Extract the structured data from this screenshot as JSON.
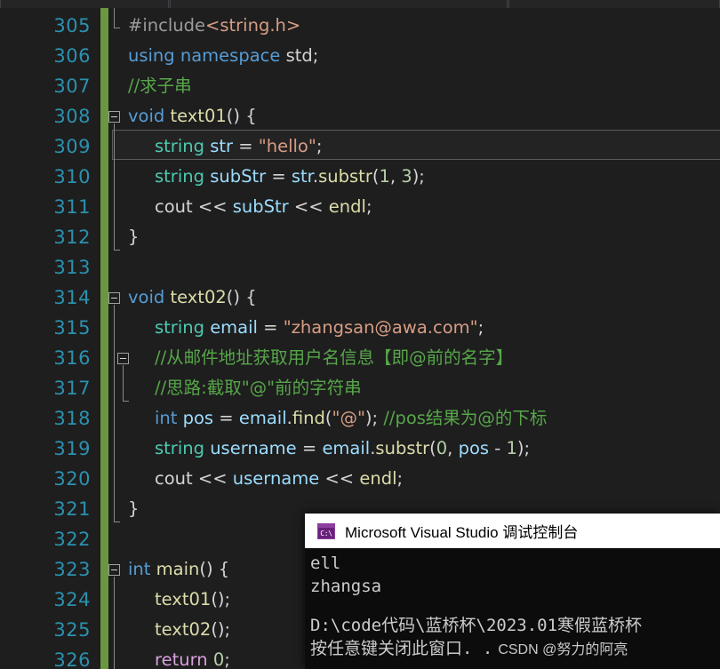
{
  "window": {
    "app": "Microsoft Visual Studio",
    "theme_name": "dark"
  },
  "editor": {
    "first_visible_line": 305,
    "last_visible_line": 326,
    "current_line": 309,
    "line_numbers": [
      "305",
      "306",
      "307",
      "308",
      "309",
      "310",
      "311",
      "312",
      "313",
      "314",
      "315",
      "316",
      "317",
      "318",
      "319",
      "320",
      "321",
      "322",
      "323",
      "324",
      "325",
      "326"
    ],
    "lines": [
      {
        "n": "305",
        "indent": 0,
        "tokens": [
          {
            "t": "#include",
            "c": "t-pre"
          },
          {
            "t": "<string.h>",
            "c": "t-prename"
          }
        ]
      },
      {
        "n": "306",
        "indent": 0,
        "tokens": [
          {
            "t": "using namespace ",
            "c": "t-kw"
          },
          {
            "t": "std",
            "c": "t-ns"
          },
          {
            "t": ";",
            "c": "t-punct"
          }
        ]
      },
      {
        "n": "307",
        "indent": 0,
        "tokens": [
          {
            "t": "//求子串",
            "c": "t-cmt"
          }
        ]
      },
      {
        "n": "308",
        "indent": 0,
        "tokens": [
          {
            "t": "void ",
            "c": "t-kw"
          },
          {
            "t": "text01",
            "c": "t-fn"
          },
          {
            "t": "() {",
            "c": "t-punct"
          }
        ]
      },
      {
        "n": "309",
        "indent": 1,
        "tokens": [
          {
            "t": "string ",
            "c": "t-type"
          },
          {
            "t": "str ",
            "c": "t-var"
          },
          {
            "t": "= ",
            "c": "t-op"
          },
          {
            "t": "\"hello\"",
            "c": "t-str"
          },
          {
            "t": ";",
            "c": "t-punct"
          }
        ]
      },
      {
        "n": "310",
        "indent": 1,
        "tokens": [
          {
            "t": "string ",
            "c": "t-type"
          },
          {
            "t": "subStr ",
            "c": "t-var"
          },
          {
            "t": "= ",
            "c": "t-op"
          },
          {
            "t": "str",
            "c": "t-var"
          },
          {
            "t": ".",
            "c": "t-punct"
          },
          {
            "t": "substr",
            "c": "t-fn"
          },
          {
            "t": "(",
            "c": "t-punct"
          },
          {
            "t": "1",
            "c": "t-num"
          },
          {
            "t": ", ",
            "c": "t-punct"
          },
          {
            "t": "3",
            "c": "t-num"
          },
          {
            "t": ");",
            "c": "t-punct"
          }
        ]
      },
      {
        "n": "311",
        "indent": 1,
        "tokens": [
          {
            "t": "cout ",
            "c": "t-punct"
          },
          {
            "t": "<< ",
            "c": "t-op"
          },
          {
            "t": "subStr ",
            "c": "t-var"
          },
          {
            "t": "<< ",
            "c": "t-op"
          },
          {
            "t": "endl",
            "c": "t-fn"
          },
          {
            "t": ";",
            "c": "t-punct"
          }
        ]
      },
      {
        "n": "312",
        "indent": 0,
        "tokens": [
          {
            "t": "}",
            "c": "t-punct"
          }
        ]
      },
      {
        "n": "313",
        "indent": 0,
        "tokens": []
      },
      {
        "n": "314",
        "indent": 0,
        "tokens": [
          {
            "t": "void ",
            "c": "t-kw"
          },
          {
            "t": "text02",
            "c": "t-fn"
          },
          {
            "t": "() {",
            "c": "t-punct"
          }
        ]
      },
      {
        "n": "315",
        "indent": 1,
        "tokens": [
          {
            "t": "string ",
            "c": "t-type"
          },
          {
            "t": "email ",
            "c": "t-var"
          },
          {
            "t": "= ",
            "c": "t-op"
          },
          {
            "t": "\"zhangsan@awa.com\"",
            "c": "t-str"
          },
          {
            "t": ";",
            "c": "t-punct"
          }
        ]
      },
      {
        "n": "316",
        "indent": 1,
        "tokens": [
          {
            "t": "//从邮件地址获取用户名信息【即@前的名字】",
            "c": "t-cmt"
          }
        ]
      },
      {
        "n": "317",
        "indent": 1,
        "tokens": [
          {
            "t": "//思路:截取\"@\"前的字符串",
            "c": "t-cmt"
          }
        ]
      },
      {
        "n": "318",
        "indent": 1,
        "tokens": [
          {
            "t": "int ",
            "c": "t-kw"
          },
          {
            "t": "pos ",
            "c": "t-var"
          },
          {
            "t": "= ",
            "c": "t-op"
          },
          {
            "t": "email",
            "c": "t-var"
          },
          {
            "t": ".",
            "c": "t-punct"
          },
          {
            "t": "find",
            "c": "t-fn"
          },
          {
            "t": "(",
            "c": "t-punct"
          },
          {
            "t": "\"@\"",
            "c": "t-str"
          },
          {
            "t": "); ",
            "c": "t-punct"
          },
          {
            "t": "//pos结果为@的下标",
            "c": "t-cmt"
          }
        ]
      },
      {
        "n": "319",
        "indent": 1,
        "tokens": [
          {
            "t": "string ",
            "c": "t-type"
          },
          {
            "t": "username ",
            "c": "t-var"
          },
          {
            "t": "= ",
            "c": "t-op"
          },
          {
            "t": "email",
            "c": "t-var"
          },
          {
            "t": ".",
            "c": "t-punct"
          },
          {
            "t": "substr",
            "c": "t-fn"
          },
          {
            "t": "(",
            "c": "t-punct"
          },
          {
            "t": "0",
            "c": "t-num"
          },
          {
            "t": ", ",
            "c": "t-punct"
          },
          {
            "t": "pos ",
            "c": "t-var"
          },
          {
            "t": "- ",
            "c": "t-op"
          },
          {
            "t": "1",
            "c": "t-num"
          },
          {
            "t": ");",
            "c": "t-punct"
          }
        ]
      },
      {
        "n": "320",
        "indent": 1,
        "tokens": [
          {
            "t": "cout ",
            "c": "t-punct"
          },
          {
            "t": "<< ",
            "c": "t-op"
          },
          {
            "t": "username ",
            "c": "t-var"
          },
          {
            "t": "<< ",
            "c": "t-op"
          },
          {
            "t": "endl",
            "c": "t-fn"
          },
          {
            "t": ";",
            "c": "t-punct"
          }
        ]
      },
      {
        "n": "321",
        "indent": 0,
        "tokens": [
          {
            "t": "}",
            "c": "t-punct"
          }
        ]
      },
      {
        "n": "322",
        "indent": 0,
        "tokens": []
      },
      {
        "n": "323",
        "indent": 0,
        "tokens": [
          {
            "t": "int ",
            "c": "t-kw"
          },
          {
            "t": "main",
            "c": "t-fn"
          },
          {
            "t": "() {",
            "c": "t-punct"
          }
        ]
      },
      {
        "n": "324",
        "indent": 1,
        "tokens": [
          {
            "t": "text01",
            "c": "t-fn"
          },
          {
            "t": "();",
            "c": "t-punct"
          }
        ]
      },
      {
        "n": "325",
        "indent": 1,
        "tokens": [
          {
            "t": "text02",
            "c": "t-fn"
          },
          {
            "t": "();",
            "c": "t-punct"
          }
        ]
      },
      {
        "n": "326",
        "indent": 1,
        "tokens": [
          {
            "t": "return ",
            "c": "t-kw2"
          },
          {
            "t": "0",
            "c": "t-num"
          },
          {
            "t": ";",
            "c": "t-punct"
          }
        ]
      }
    ],
    "fold_markers": [
      {
        "line": "308",
        "state": "expanded"
      },
      {
        "line": "314",
        "state": "expanded"
      },
      {
        "line": "316",
        "state": "expanded"
      },
      {
        "line": "323",
        "state": "expanded"
      }
    ],
    "colors": {
      "background": "#1e1e1e",
      "line_number": "#2b91af",
      "changed_track": "#6a9741",
      "comment": "#57a64a",
      "keyword": "#569cd6",
      "string": "#d69d85",
      "number": "#b5cea8",
      "function": "#dcdcaa",
      "type": "#4ec9b0",
      "identifier": "#9cdcfe",
      "return_keyword": "#d8a0df"
    }
  },
  "console": {
    "title": "Microsoft Visual Studio 调试控制台",
    "icon": "console-window-icon",
    "icon_glyph": "C:\\",
    "output_lines": [
      "ell",
      "zhangsa",
      "",
      "D:\\code代码\\蓝桥杯\\2023.01寒假蓝桥杯"
    ],
    "prompt_line": "按任意键关闭此窗口. .",
    "watermark": "CSDN @努力的阿亮",
    "colors": {
      "titlebar_background": "#ffffff",
      "titlebar_text": "#000000",
      "body_background": "#0c0c0c",
      "body_text": "#cccccc",
      "icon_background": "#68217a"
    }
  }
}
